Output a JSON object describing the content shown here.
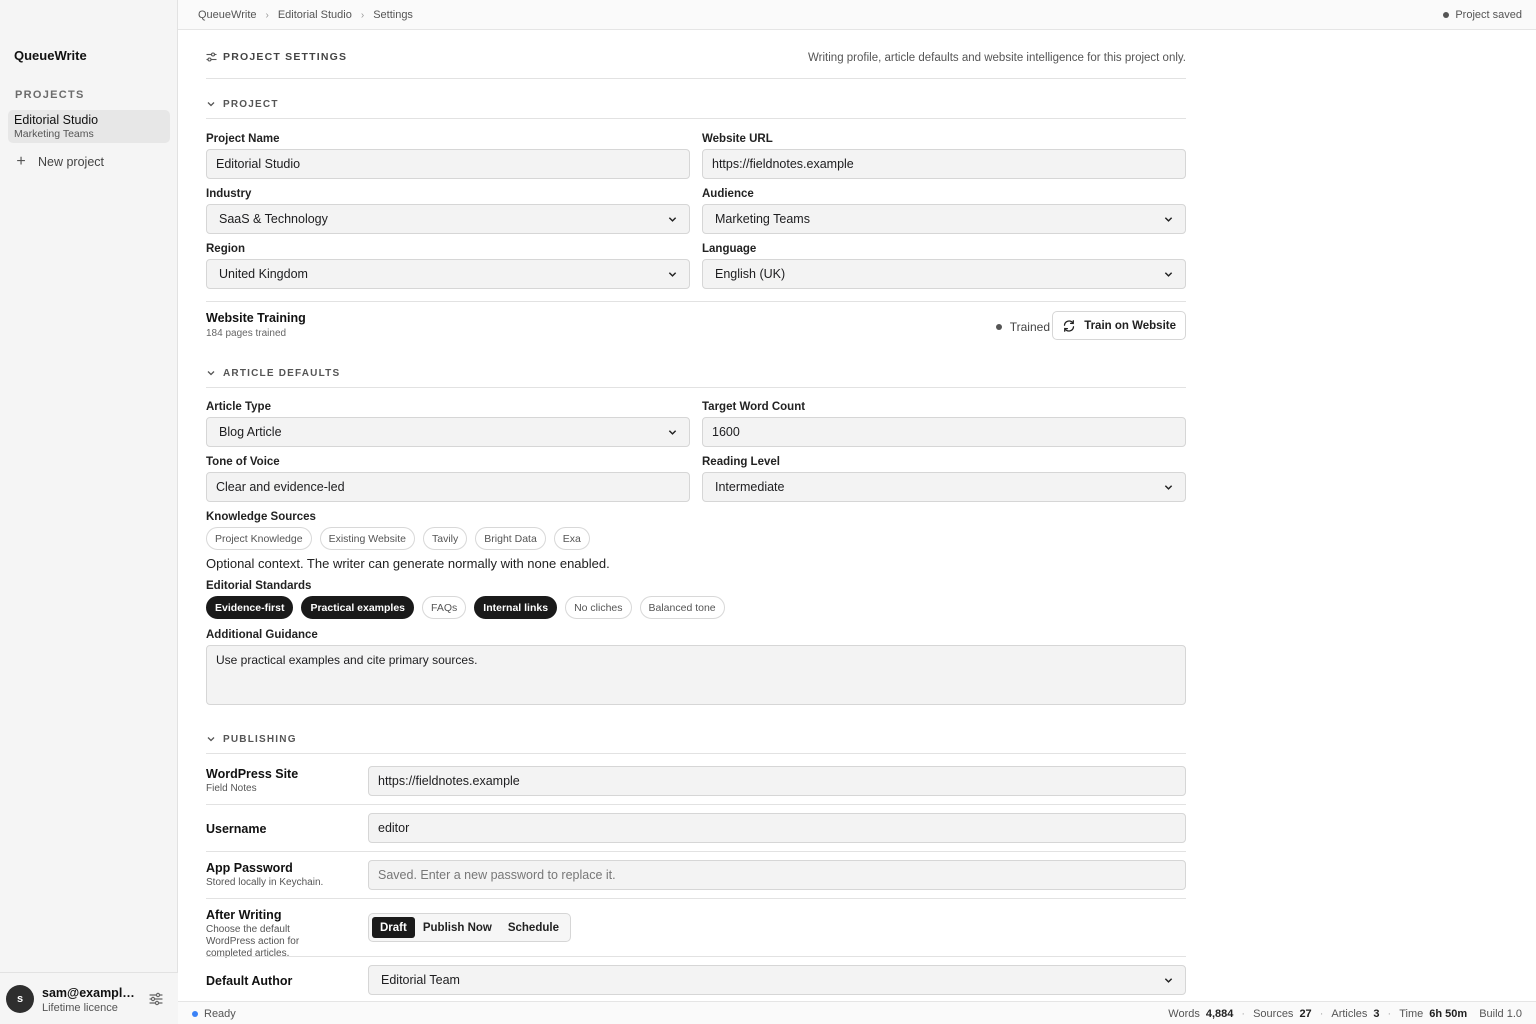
{
  "app": {
    "name": "QueueWrite"
  },
  "sidebar": {
    "projects_heading": "PROJECTS",
    "projects": [
      {
        "name": "Editorial Studio",
        "subtitle": "Marketing Teams",
        "selected": true
      }
    ],
    "new_project_label": "New project",
    "user": {
      "initial": "s",
      "email": "sam@example.com",
      "plan": "Lifetime licence"
    }
  },
  "topbar": {
    "breadcrumbs": [
      "QueueWrite",
      "Editorial Studio",
      "Settings"
    ],
    "save_status": "Project saved"
  },
  "settings": {
    "title": "PROJECT SETTINGS",
    "description": "Writing profile, article defaults and website intelligence for this project only."
  },
  "project_section": {
    "heading": "PROJECT",
    "project_name": {
      "label": "Project Name",
      "value": "Editorial Studio"
    },
    "website_url": {
      "label": "Website URL",
      "value": "https://fieldnotes.example"
    },
    "industry": {
      "label": "Industry",
      "value": "SaaS & Technology"
    },
    "audience": {
      "label": "Audience",
      "value": "Marketing Teams"
    },
    "region": {
      "label": "Region",
      "value": "United Kingdom"
    },
    "language": {
      "label": "Language",
      "value": "English (UK)"
    },
    "training": {
      "title": "Website Training",
      "subtitle": "184 pages trained",
      "status": "Trained",
      "button_label": "Train on Website"
    }
  },
  "article_section": {
    "heading": "ARTICLE DEFAULTS",
    "article_type": {
      "label": "Article Type",
      "value": "Blog Article"
    },
    "target_word_count": {
      "label": "Target Word Count",
      "value": "1600"
    },
    "tone": {
      "label": "Tone of Voice",
      "value": "Clear and evidence-led"
    },
    "reading_level": {
      "label": "Reading Level",
      "value": "Intermediate"
    },
    "knowledge_sources": {
      "label": "Knowledge Sources",
      "items": [
        {
          "label": "Project Knowledge",
          "on": false
        },
        {
          "label": "Existing Website",
          "on": false
        },
        {
          "label": "Tavily",
          "on": false
        },
        {
          "label": "Bright Data",
          "on": false
        },
        {
          "label": "Exa",
          "on": false
        }
      ],
      "helper": "Optional context. The writer can generate normally with none enabled."
    },
    "editorial_standards": {
      "label": "Editorial Standards",
      "items": [
        {
          "label": "Evidence-first",
          "on": true
        },
        {
          "label": "Practical examples",
          "on": true
        },
        {
          "label": "FAQs",
          "on": false
        },
        {
          "label": "Internal links",
          "on": true
        },
        {
          "label": "No cliches",
          "on": false
        },
        {
          "label": "Balanced tone",
          "on": false
        }
      ]
    },
    "additional_guidance": {
      "label": "Additional Guidance",
      "value": "Use practical examples and cite primary sources."
    }
  },
  "publishing_section": {
    "heading": "PUBLISHING",
    "wordpress_site": {
      "label": "WordPress Site",
      "subtitle": "Field Notes",
      "value": "https://fieldnotes.example"
    },
    "username": {
      "label": "Username",
      "value": "editor"
    },
    "app_password": {
      "label": "App Password",
      "subtitle": "Stored locally in Keychain.",
      "placeholder": "Saved. Enter a new password to replace it."
    },
    "after_writing": {
      "label": "After Writing",
      "subtitle": "Choose the default WordPress action for completed articles.",
      "options": [
        "Draft",
        "Publish Now",
        "Schedule"
      ],
      "selected": "Draft"
    },
    "default_author": {
      "label": "Default Author",
      "value": "Editorial Team"
    }
  },
  "statusbar": {
    "status": "Ready",
    "words_label": "Words",
    "words": "4,884",
    "sources_label": "Sources",
    "sources": "27",
    "articles_label": "Articles",
    "articles": "3",
    "time_label": "Time",
    "time": "6h 50m",
    "build": "Build 1.0"
  },
  "colors": {
    "accent": "#1a1a1a",
    "ready_dot": "#3b82f6",
    "sidebar_bg": "#f5f5f5"
  },
  "icons": [
    "sliders-icon",
    "plus-icon",
    "chevron-down-icon",
    "refresh-icon",
    "settings-sliders-icon",
    "chevron-right-icon"
  ]
}
